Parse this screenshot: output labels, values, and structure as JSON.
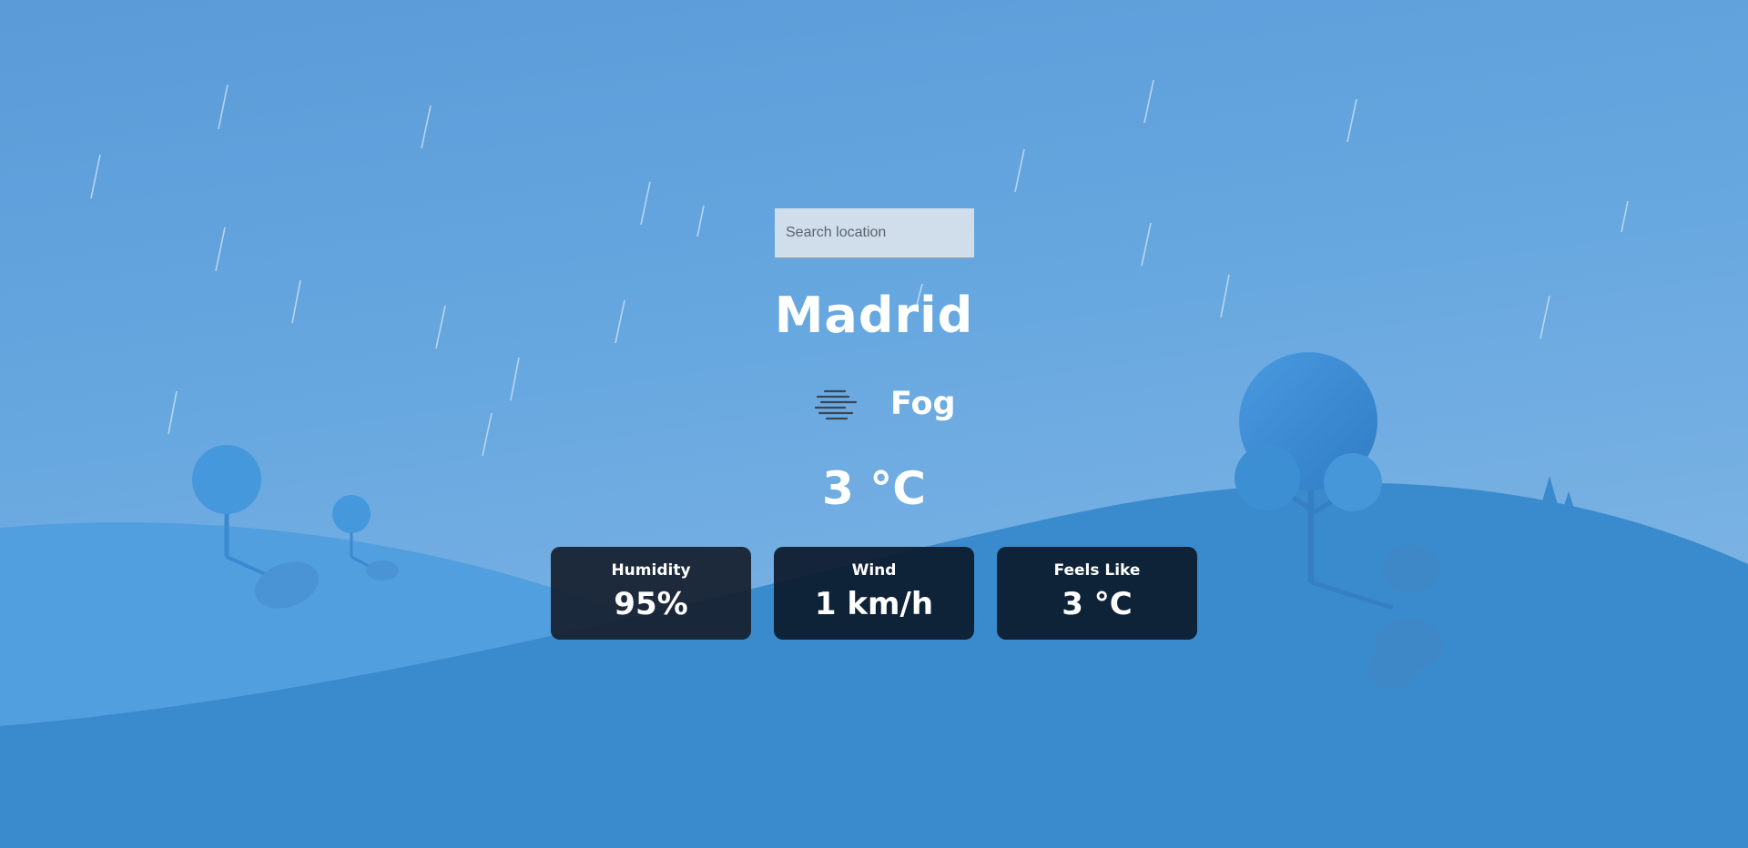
{
  "search": {
    "placeholder": "Search location",
    "value": ""
  },
  "location": {
    "city": "Madrid"
  },
  "condition": {
    "label": "Fog",
    "icon": "fog-icon"
  },
  "temperature": "3 °C",
  "stats": [
    {
      "label": "Humidity",
      "value": "95%"
    },
    {
      "label": "Wind",
      "value": "1 km/h"
    },
    {
      "label": "Feels Like",
      "value": "3 °C"
    }
  ],
  "colors": {
    "sky_top": "#5a9cd9",
    "sky_bottom": "#7eb2e2",
    "hill_far": "#4f9adf",
    "hill_near": "#3a8acd",
    "card_bg": "#0b1a2e",
    "text": "#ffffff"
  }
}
